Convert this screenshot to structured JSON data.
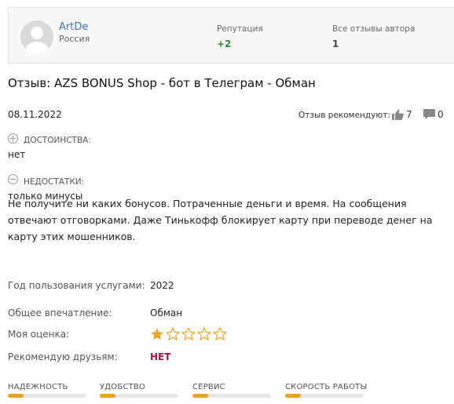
{
  "author": {
    "name": "ArtDe",
    "country": "Россия"
  },
  "stats": {
    "reputation_label": "Репутация",
    "reputation_value": "+2",
    "reviews_label": "Все отзывы автора",
    "reviews_value": "1"
  },
  "review": {
    "title": "Отзыв: AZS BONUS Shop - бот в Телеграм - Обман",
    "date": "08.11.2022",
    "recommend_label": "Отзыв рекомендуют:",
    "likes": "7",
    "comments": "0",
    "pros_label": "ДОСТОИНСТВА:",
    "pros_value": "нет",
    "cons_label": "НЕДОСТАТКИ:",
    "cons_value": "только минусы",
    "text": "Не получите ни каких бонусов. Потраченные деньги и время. На сообщения отвечают отговорками. Даже Тинькофф блокирует карту при переводе денег на карту этих мошенников."
  },
  "properties": {
    "year_label": "Год пользования услугами:",
    "year_value": "2022",
    "impression_label": "Общее впечатление:",
    "impression_value": "Обман",
    "rating_label": "Моя оценка:",
    "rating": 1,
    "rating_max": 5,
    "recommend_label": "Рекомендую друзьям:",
    "recommend_value": "НЕТ"
  },
  "metrics": [
    {
      "label": "НАДЕЖНОСТЬ",
      "value": 0.2
    },
    {
      "label": "УДОБСТВО",
      "value": 0.2
    },
    {
      "label": "СЕРВИС",
      "value": 0.2
    },
    {
      "label": "СКОРОСТЬ РАБОТЫ",
      "value": 0.2
    }
  ],
  "colors": {
    "link": "#3a76b2",
    "positive": "#2e8b3a",
    "negative": "#a2144a",
    "star": "#f0a020"
  }
}
